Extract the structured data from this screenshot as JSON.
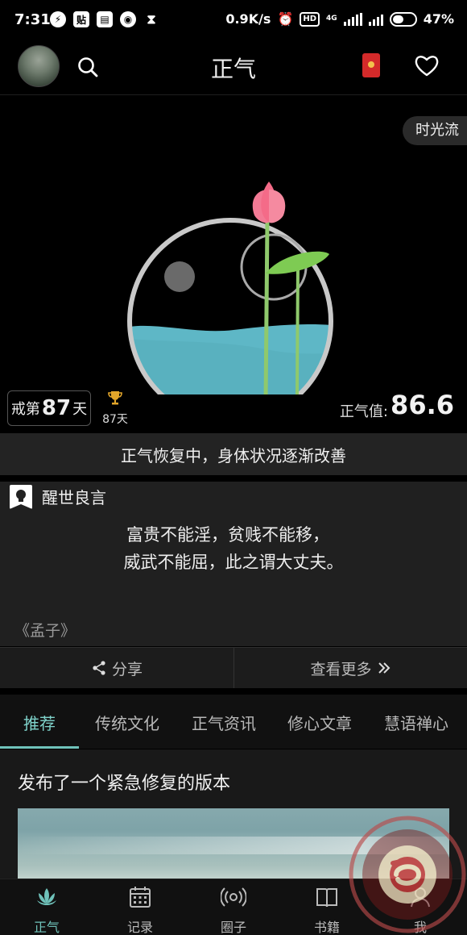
{
  "status_bar": {
    "time": "7:31",
    "icon_tie": "贴",
    "network_speed": "0.9K/s",
    "hd": "HD",
    "network_type": "4G",
    "battery": "47%"
  },
  "header": {
    "title": "正气"
  },
  "hero": {
    "time_flow_label": "时光流",
    "days_prefix": "戒第",
    "days_count": "87",
    "days_suffix": "天",
    "trophy_days": "87天",
    "zhengqi_label": "正气值:",
    "zhengqi_value": "86.6"
  },
  "status_message": "正气恢复中，身体状况逐渐改善",
  "quote": {
    "section_title": "醒世良言",
    "line1": "富贵不能淫，贫贱不能移，",
    "line2": "威武不能屈，此之谓大丈夫。",
    "source": "《孟子》",
    "share_label": "分享",
    "more_label": "查看更多"
  },
  "tabs": [
    {
      "label": "推荐",
      "active": true
    },
    {
      "label": "传统文化",
      "active": false
    },
    {
      "label": "正气资讯",
      "active": false
    },
    {
      "label": "修心文章",
      "active": false
    },
    {
      "label": "慧语禅心",
      "active": false
    }
  ],
  "feed": {
    "post_title": "发布了一个紧急修复的版本"
  },
  "bottom_nav": [
    {
      "label": "正气",
      "icon": "lotus-icon",
      "active": true
    },
    {
      "label": "记录",
      "icon": "calendar-icon",
      "active": false
    },
    {
      "label": "圈子",
      "icon": "broadcast-icon",
      "active": false
    },
    {
      "label": "书籍",
      "icon": "book-icon",
      "active": false
    },
    {
      "label": "我",
      "icon": "user-icon",
      "active": false
    }
  ],
  "colors": {
    "accent": "#6fc2ba",
    "background": "#000000",
    "card": "#202020",
    "water": "#5bb3c3",
    "lotus": "#f06b8a",
    "leaf": "#7fc34f"
  }
}
